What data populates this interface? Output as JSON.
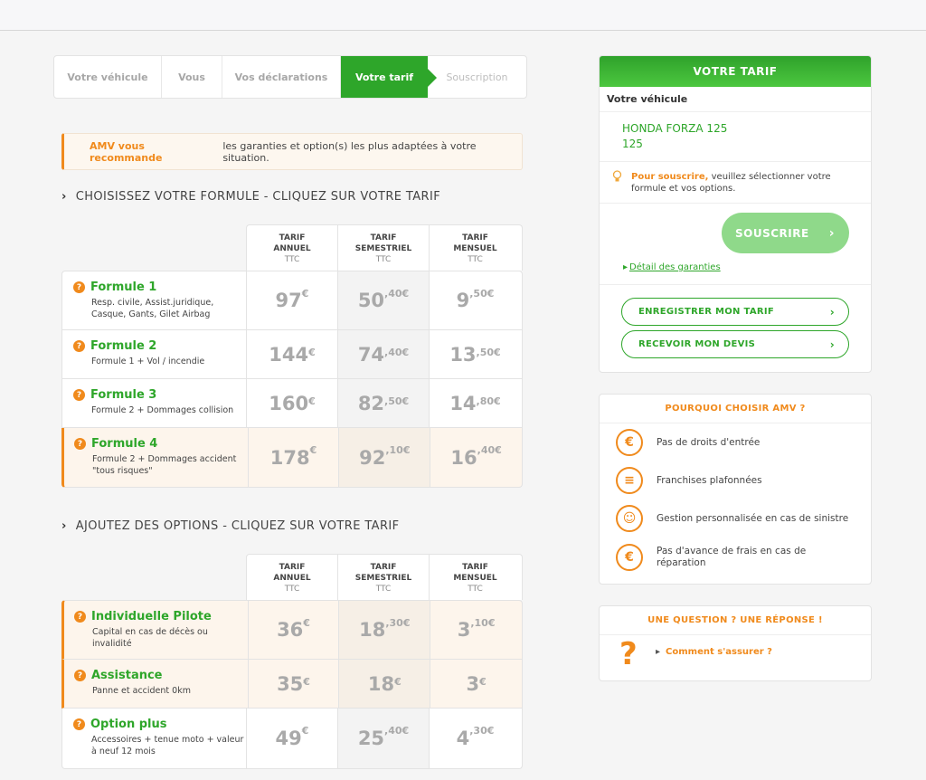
{
  "stepper": {
    "steps": [
      "Votre véhicule",
      "Vous",
      "Vos déclarations",
      "Votre tarif",
      "Souscription"
    ]
  },
  "reco": {
    "highlight": "AMV vous recommande",
    "text": "les garanties et option(s) les plus adaptées à votre situation."
  },
  "section1_title": "CHOISISSEZ VOTRE FORMULE - CLIQUEZ SUR VOTRE TARIF",
  "section2_title": "AJOUTEZ DES OPTIONS - CLIQUEZ SUR VOTRE TARIF",
  "headers": {
    "annuel": [
      "TARIF",
      "ANNUEL"
    ],
    "semestriel": [
      "TARIF",
      "SEMESTRIEL"
    ],
    "mensuel": [
      "TARIF",
      "MENSUEL"
    ],
    "ttc": "TTC"
  },
  "formules": [
    {
      "name": "Formule 1",
      "desc": "Resp. civile, Assist.juridique, Casque, Gants, Gilet Airbag",
      "annuel": [
        "97",
        "€"
      ],
      "semestriel": [
        "50",
        ",40€"
      ],
      "mensuel": [
        "9",
        ",50€"
      ]
    },
    {
      "name": "Formule 2",
      "desc": "Formule 1 + Vol / incendie",
      "annuel": [
        "144",
        "€"
      ],
      "semestriel": [
        "74",
        ",40€"
      ],
      "mensuel": [
        "13",
        ",50€"
      ]
    },
    {
      "name": "Formule 3",
      "desc": "Formule 2 + Dommages collision",
      "annuel": [
        "160",
        "€"
      ],
      "semestriel": [
        "82",
        ",50€"
      ],
      "mensuel": [
        "14",
        ",80€"
      ]
    },
    {
      "name": "Formule 4",
      "desc": "Formule 2 + Dommages accident \"tous risques\"",
      "annuel": [
        "178",
        "€"
      ],
      "semestriel": [
        "92",
        ",10€"
      ],
      "mensuel": [
        "16",
        ",40€"
      ]
    }
  ],
  "options": [
    {
      "name": "Individuelle Pilote",
      "desc": "Capital en cas de décès ou invalidité",
      "annuel": [
        "36",
        "€"
      ],
      "semestriel": [
        "18",
        ",30€"
      ],
      "mensuel": [
        "3",
        ",10€"
      ]
    },
    {
      "name": "Assistance",
      "desc": "Panne et accident 0km",
      "annuel": [
        "35",
        "€"
      ],
      "semestriel": [
        "18",
        "€"
      ],
      "mensuel": [
        "3",
        "€"
      ]
    },
    {
      "name": "Option plus",
      "desc": "Accessoires + tenue moto + valeur à neuf 12 mois",
      "annuel": [
        "49",
        "€"
      ],
      "semestriel": [
        "25",
        ",40€"
      ],
      "mensuel": [
        "4",
        ",30€"
      ]
    }
  ],
  "tarif": {
    "title": "VOTRE TARIF",
    "vehicle_label": "Votre véhicule",
    "vehicle_name": "HONDA FORZA 125",
    "vehicle_cc": "125",
    "note_bold": "Pour souscrire,",
    "note_text": "veuillez sélectionner votre formule et vos options.",
    "souscrire": "SOUSCRIRE",
    "detail": "Détail des garanties",
    "save": "ENREGISTRER MON TARIF",
    "devis": "RECEVOIR MON DEVIS"
  },
  "why": {
    "title": "POURQUOI CHOISIR AMV ?",
    "items": [
      "Pas de droits d'entrée",
      "Franchises plafonnées",
      "Gestion personnalisée en cas de sinistre",
      "Pas d'avance de frais en cas de réparation"
    ]
  },
  "faq": {
    "title": "UNE QUESTION ? UNE RÉPONSE !",
    "link": "Comment s'assurer ?"
  },
  "colors": {
    "green": "#2ea62a",
    "orange": "#f08a1c"
  }
}
